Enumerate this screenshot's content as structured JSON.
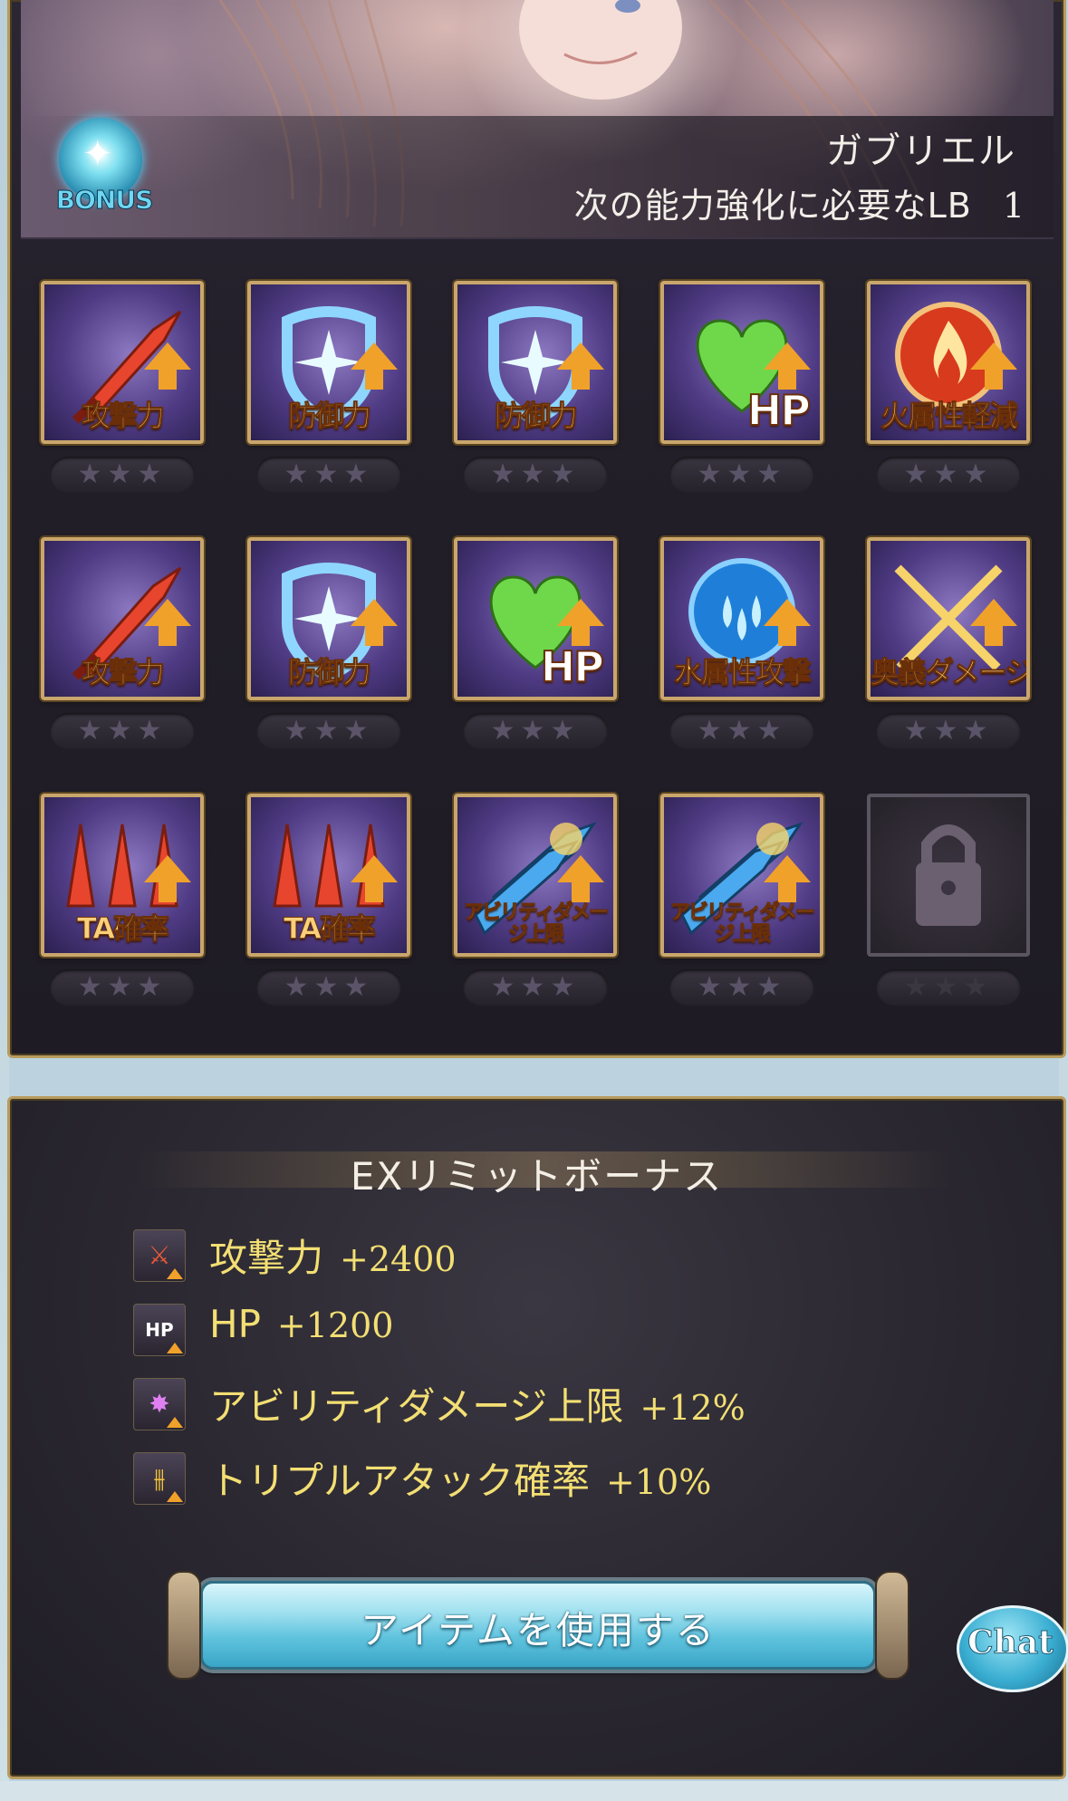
{
  "header": {
    "character_name": "ガブリエル",
    "lb_label": "次の能力強化に必要なLB",
    "lb_value": "1",
    "bonus_badge_text": "BONUS"
  },
  "grid": {
    "tiles": [
      {
        "label": "攻撃力",
        "icon": "sword-icon",
        "stars": "★★★"
      },
      {
        "label": "防御力",
        "icon": "shield-icon",
        "stars": "★★★"
      },
      {
        "label": "防御力",
        "icon": "shield-icon",
        "stars": "★★★"
      },
      {
        "label": "HP",
        "icon": "heart-icon",
        "stars": "★★★"
      },
      {
        "label": "火属性軽減",
        "icon": "fire-icon",
        "stars": "★★★"
      },
      {
        "label": "攻撃力",
        "icon": "sword-icon",
        "stars": "★★★"
      },
      {
        "label": "防御力",
        "icon": "shield-icon",
        "stars": "★★★"
      },
      {
        "label": "HP",
        "icon": "heart-icon",
        "stars": "★★★"
      },
      {
        "label": "水属性攻撃",
        "icon": "water-icon",
        "stars": "★★★"
      },
      {
        "label": "奥義ダメージ",
        "icon": "crossed-swords-icon",
        "stars": "★★★"
      },
      {
        "label": "TA確率",
        "icon": "triple-spear-icon",
        "stars": "★★★"
      },
      {
        "label": "TA確率",
        "icon": "triple-spear-icon",
        "stars": "★★★"
      },
      {
        "label": "アビリティダメージ上限",
        "icon": "ability-blade-icon",
        "stars": "★★★"
      },
      {
        "label": "アビリティダメージ上限",
        "icon": "ability-blade-icon",
        "stars": "★★★"
      },
      {
        "label": "",
        "icon": "lock-icon",
        "stars": "★★★"
      }
    ]
  },
  "ex_bonus": {
    "title": "EXリミットボーナス",
    "rows": [
      {
        "name": "攻撃力",
        "value": "+2400",
        "icon": "sword-icon"
      },
      {
        "name": "HP",
        "value": "+1200",
        "icon": "hp-icon"
      },
      {
        "name": "アビリティダメージ上限",
        "value": "+12%",
        "icon": "ability-spark-icon"
      },
      {
        "name": "トリプルアタック確率",
        "value": "+10%",
        "icon": "triple-spear-icon"
      }
    ]
  },
  "actions": {
    "use_item_label": "アイテムを使用する",
    "chat_label": "Chat"
  },
  "colors": {
    "gold_frame": "#b89b5e",
    "bonus_text": "#f3df73",
    "button_blue": "#5fc3de",
    "upgrade_arrow": "#f0a12a"
  }
}
